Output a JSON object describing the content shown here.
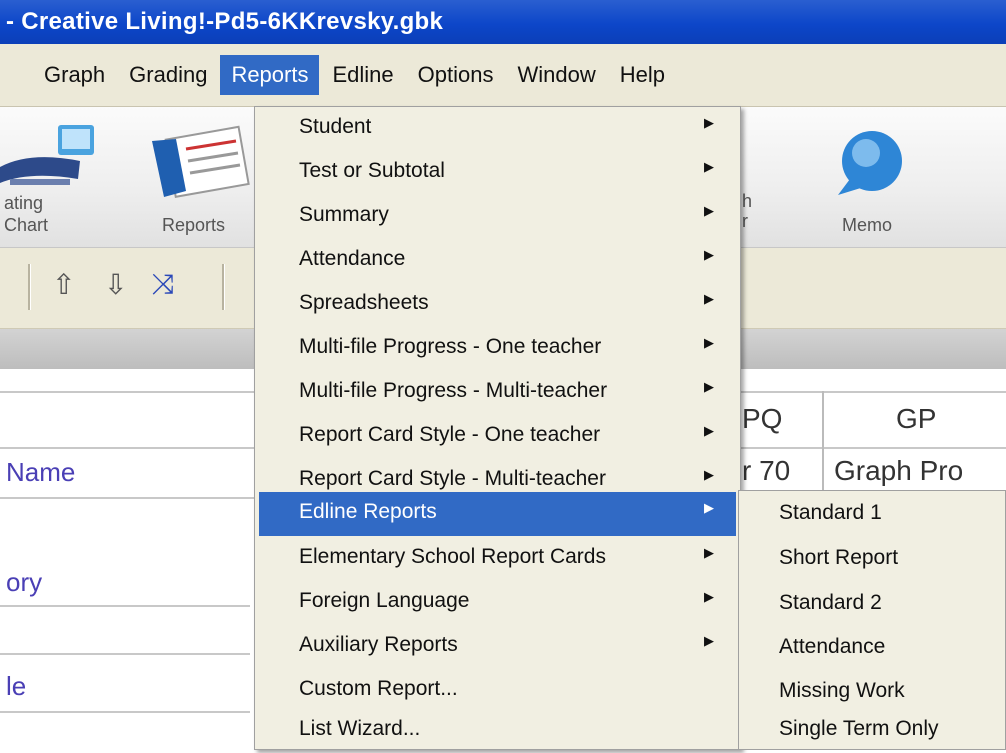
{
  "window": {
    "title": "- Creative Living!-Pd5-6KKrevsky.gbk"
  },
  "menubar": {
    "items": [
      {
        "label": "Graph"
      },
      {
        "label": "Grading"
      },
      {
        "label": "Reports"
      },
      {
        "label": "Edline"
      },
      {
        "label": "Options"
      },
      {
        "label": "Window"
      },
      {
        "label": "Help"
      }
    ],
    "active": "Reports"
  },
  "toolbar": {
    "seating_chart_label_1": "ating",
    "seating_chart_label_2": "Chart",
    "reports_label": "Reports",
    "partial_label_1": "h",
    "partial_label_2": "r",
    "memo_label": "Memo"
  },
  "grid": {
    "headers": [
      "PQ",
      "GP"
    ],
    "row2_cells": [
      "r 70",
      "Graph Pro"
    ],
    "row_labels": [
      "Name",
      "ory",
      "le"
    ]
  },
  "reports_menu": {
    "items": [
      {
        "label": "Student",
        "submenu": true
      },
      {
        "label": "Test or Subtotal",
        "submenu": true
      },
      {
        "label": "Summary",
        "submenu": true
      },
      {
        "label": "Attendance",
        "submenu": true
      },
      {
        "label": "Spreadsheets",
        "submenu": true
      },
      {
        "label": "Multi-file Progress - One teacher",
        "submenu": true
      },
      {
        "label": "Multi-file Progress - Multi-teacher",
        "submenu": true
      },
      {
        "label": "Report Card Style - One teacher",
        "submenu": true
      },
      {
        "label": "Report Card Style - Multi-teacher",
        "submenu": true
      },
      {
        "label": "Edline Reports",
        "submenu": true,
        "highlighted": true
      },
      {
        "label": "Elementary School Report Cards",
        "submenu": true
      },
      {
        "label": "Foreign Language",
        "submenu": true
      },
      {
        "label": "Auxiliary Reports",
        "submenu": true
      },
      {
        "label": "Custom Report...",
        "submenu": false
      },
      {
        "label": "List Wizard...",
        "submenu": false
      }
    ]
  },
  "edline_submenu": {
    "items": [
      {
        "label": "Standard 1"
      },
      {
        "label": "Short Report"
      },
      {
        "label": "Standard 2"
      },
      {
        "label": "Attendance"
      },
      {
        "label": "Missing Work"
      },
      {
        "label": "Single Term Only"
      }
    ]
  },
  "colors": {
    "titlebar": "#0d46c9",
    "menu_highlight": "#316ac5",
    "menu_bg": "#f1efe2",
    "row_label": "#4a3fb5"
  }
}
